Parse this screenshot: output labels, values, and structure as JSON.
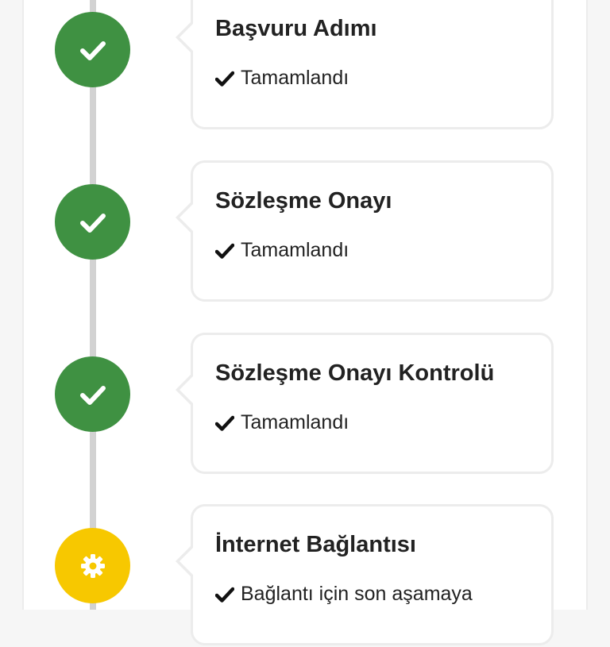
{
  "steps": [
    {
      "title": "Başvuru Adımı",
      "status": "Tamamlandı",
      "state": "completed",
      "icon": "check-icon"
    },
    {
      "title": "Sözleşme Onayı",
      "status": "Tamamlandı",
      "state": "completed",
      "icon": "check-icon"
    },
    {
      "title": "Sözleşme Onayı Kontrolü",
      "status": "Tamamlandı",
      "state": "completed",
      "icon": "check-icon"
    },
    {
      "title": "İnternet Bağlantısı",
      "status": "Bağlantı için son aşamaya",
      "state": "in-progress",
      "icon": "gear-icon"
    }
  ],
  "colors": {
    "completed": "#3f9142",
    "in_progress": "#f7c800",
    "line": "#d2d2d2",
    "card_border": "#ececec",
    "text": "#222222"
  }
}
